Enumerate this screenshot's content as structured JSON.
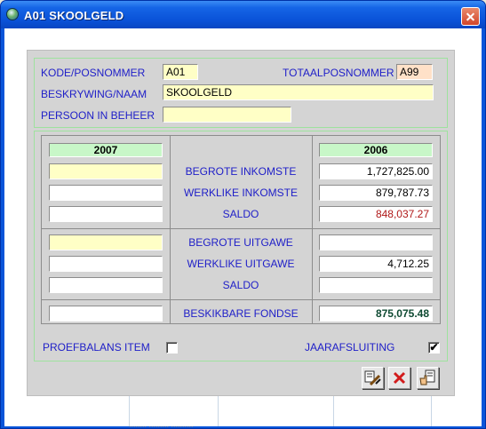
{
  "window": {
    "title": "A01 SKOOLGELD"
  },
  "header": {
    "kode_label": "KODE/POSNOMMER",
    "kode_value": "A01",
    "totaal_label": "TOTAALPOSNOMMER",
    "totaal_value": "A99",
    "beskrywing_label": "BESKRYWING/NAAM",
    "beskrywing_value": "SKOOLGELD",
    "persoon_label": "PERSOON IN BEHEER",
    "persoon_value": ""
  },
  "grid": {
    "year_left": "2007",
    "year_right": "2006",
    "rows": [
      {
        "label": "BEGROTE INKOMSTE",
        "left": "",
        "right": "1,727,825.00"
      },
      {
        "label": "WERKLIKE INKOMSTE",
        "left": "",
        "right": "879,787.73"
      },
      {
        "label": "SALDO",
        "left": "",
        "right": "848,037.27"
      },
      {
        "label": "BEGROTE UITGAWE",
        "left": "",
        "right": ""
      },
      {
        "label": "WERKLIKE UITGAWE",
        "left": "",
        "right": "4,712.25"
      },
      {
        "label": "SALDO",
        "left": "",
        "right": ""
      },
      {
        "label": "BESKIKBARE FONDSE",
        "left": "",
        "right": "875,075.48"
      }
    ]
  },
  "footer": {
    "proefbalans_label": "PROEFBALANS ITEM",
    "proefbalans_checked": false,
    "jaarafsluiting_label": "JAARAFSLUITING",
    "jaarafsluiting_checked": true,
    "jaarafsluiting_mark": "✔"
  },
  "buttons": [
    {
      "name": "edit-tool-button",
      "icon": "pencil-ruler-icon"
    },
    {
      "name": "delete-button",
      "icon": "red-x-icon"
    },
    {
      "name": "confirm-button",
      "icon": "hand-document-icon"
    }
  ],
  "background": {
    "strip_text": "........  .........  .........."
  }
}
